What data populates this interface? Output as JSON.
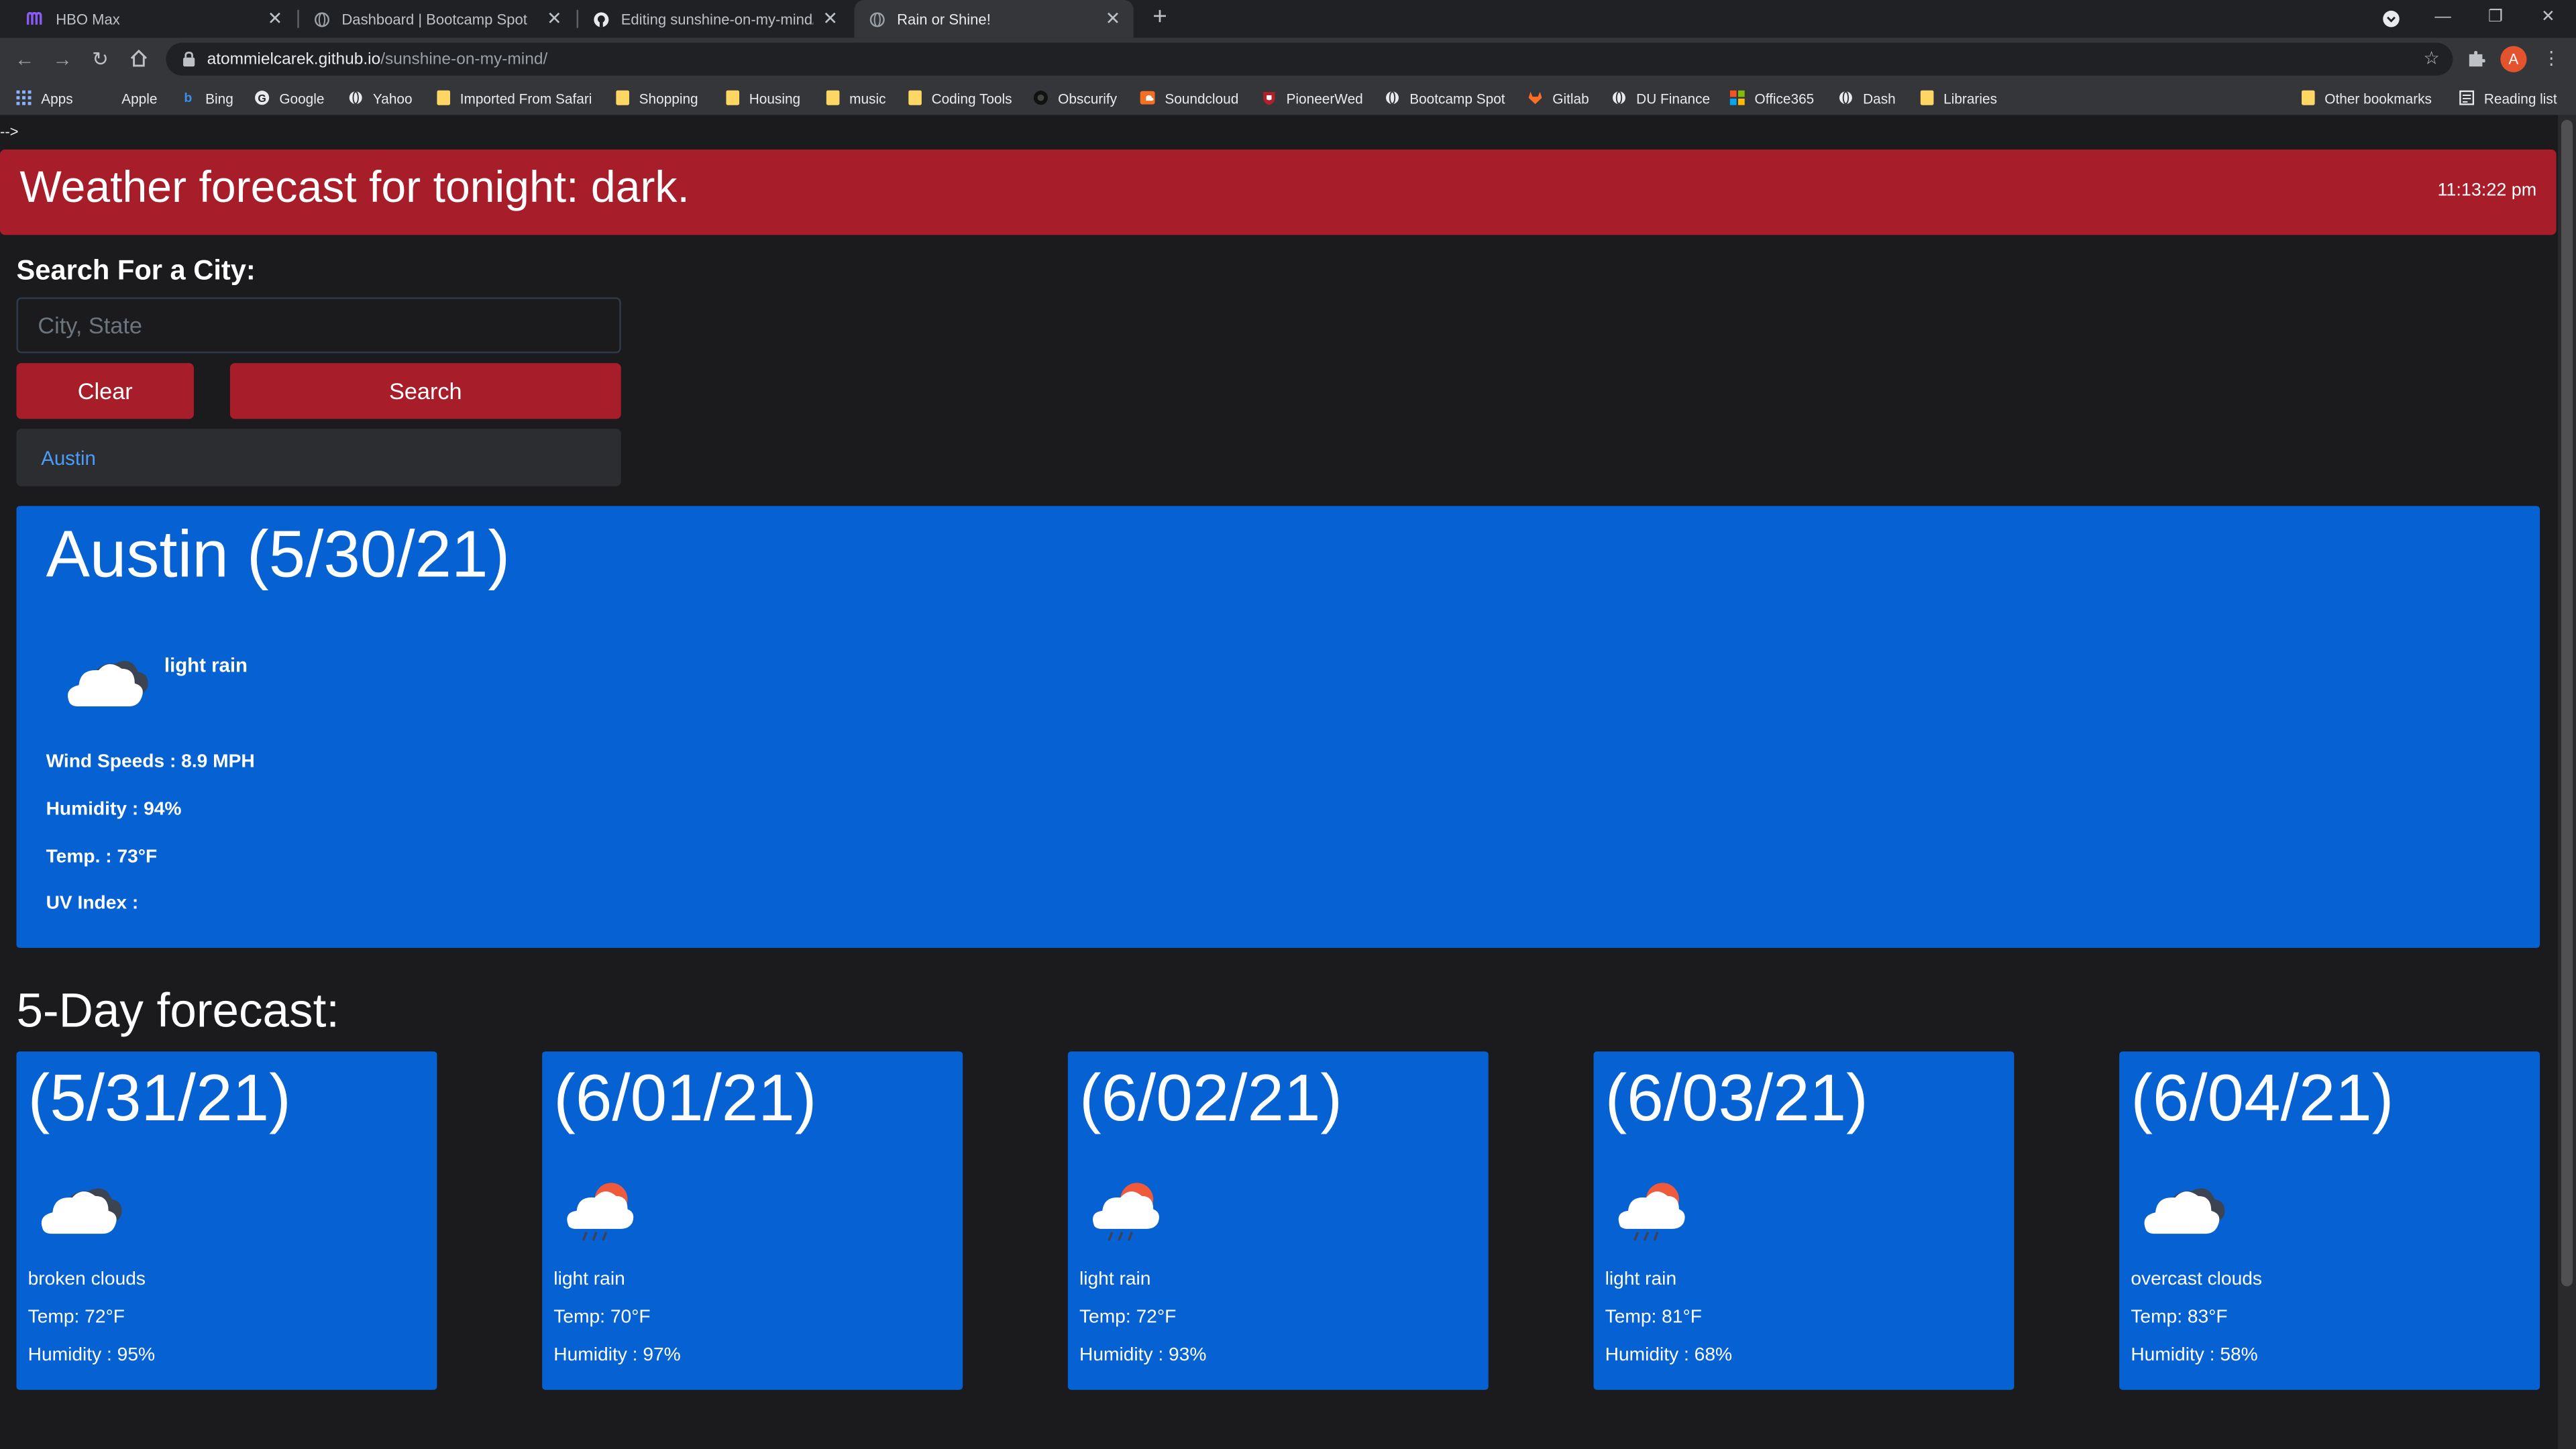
{
  "browser": {
    "tabs": [
      {
        "title": "HBO Max",
        "favicon": "hbo-max-icon"
      },
      {
        "title": "Dashboard | Bootcamp Spot",
        "favicon": "globe-icon"
      },
      {
        "title": "Editing sunshine-on-my-mind/R",
        "favicon": "github-icon"
      },
      {
        "title": "Rain or Shine!",
        "favicon": "globe-icon",
        "active": true
      }
    ],
    "url_domain": "atommielcarek.github.io",
    "url_path": "/sunshine-on-my-mind/",
    "profile_initial": "A",
    "bookmarks": [
      {
        "label": "Apps",
        "icon": "apps-grid-icon"
      },
      {
        "label": "Apple",
        "icon": "apple-icon"
      },
      {
        "label": "Bing",
        "icon": "bing-icon"
      },
      {
        "label": "Google",
        "icon": "google-icon"
      },
      {
        "label": "Yahoo",
        "icon": "globe-icon"
      },
      {
        "label": "Imported From Safari",
        "icon": "folder-icon"
      },
      {
        "label": "Shopping",
        "icon": "folder-icon"
      },
      {
        "label": "Housing",
        "icon": "folder-icon"
      },
      {
        "label": "music",
        "icon": "folder-icon"
      },
      {
        "label": "Coding Tools",
        "icon": "folder-icon"
      },
      {
        "label": "Obscurify",
        "icon": "obscurify-icon"
      },
      {
        "label": "Soundcloud",
        "icon": "soundcloud-icon"
      },
      {
        "label": "PioneerWed",
        "icon": "pioneer-shield-icon"
      },
      {
        "label": "Bootcamp Spot",
        "icon": "globe-icon"
      },
      {
        "label": "Gitlab",
        "icon": "gitlab-icon"
      },
      {
        "label": "DU Finance",
        "icon": "globe-icon"
      },
      {
        "label": "Office365",
        "icon": "office365-icon"
      },
      {
        "label": "Dash",
        "icon": "globe-icon"
      },
      {
        "label": "Libraries",
        "icon": "folder-icon"
      }
    ],
    "other_bookmarks": "Other bookmarks",
    "reading_list": "Reading list"
  },
  "page": {
    "stray_text": "-->",
    "header_title": "Weather forecast for tonight: dark.",
    "clock": "11:13:22 pm",
    "search": {
      "heading": "Search For a City:",
      "placeholder": "City, State",
      "value": "",
      "clear_label": "Clear",
      "search_label": "Search"
    },
    "history": [
      "Austin"
    ],
    "current": {
      "title": "Austin (5/30/21)",
      "icon": "rain-cloud-icon",
      "description": "light rain",
      "wind": "Wind Speeds : 8.9 MPH",
      "humidity": "Humidity : 94%",
      "temp": "Temp. : 73°F",
      "uv": "UV Index :"
    },
    "forecast_heading": "5-Day forecast:",
    "forecast": [
      {
        "date": "(5/31/21)",
        "icon": "broken-clouds-icon",
        "description": "broken clouds",
        "temp": "Temp: 72°F",
        "humidity": "Humidity : 95%"
      },
      {
        "date": "(6/01/21)",
        "icon": "sun-rain-cloud-icon",
        "description": "light rain",
        "temp": "Temp: 70°F",
        "humidity": "Humidity : 97%"
      },
      {
        "date": "(6/02/21)",
        "icon": "sun-rain-cloud-icon",
        "description": "light rain",
        "temp": "Temp: 72°F",
        "humidity": "Humidity : 93%"
      },
      {
        "date": "(6/03/21)",
        "icon": "sun-rain-cloud-icon",
        "description": "light rain",
        "temp": "Temp: 81°F",
        "humidity": "Humidity : 68%"
      },
      {
        "date": "(6/04/21)",
        "icon": "overcast-clouds-icon",
        "description": "overcast clouds",
        "temp": "Temp: 83°F",
        "humidity": "Humidity : 58%"
      }
    ]
  },
  "colors": {
    "header_red": "#a71d2a",
    "card_blue": "#0661d2",
    "page_bg": "#1b1b1d",
    "link_blue": "#4a9df8"
  }
}
